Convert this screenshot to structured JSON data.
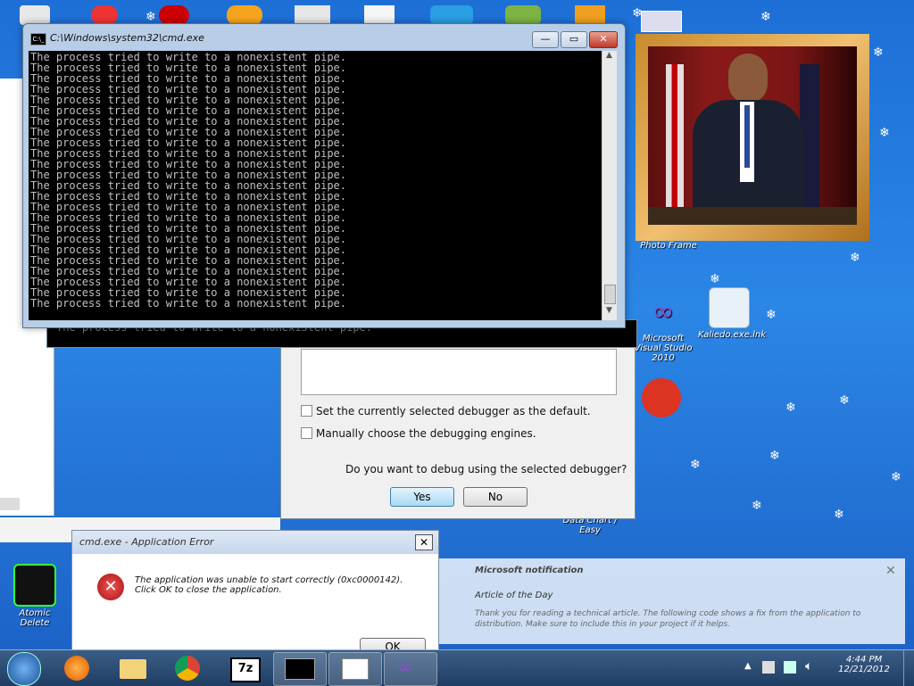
{
  "cmd_window": {
    "title": "C:\\Windows\\system32\\cmd.exe",
    "lines": [
      "The process tried to write to a nonexistent pipe.",
      "The process tried to write to a nonexistent pipe.",
      "The process tried to write to a nonexistent pipe.",
      "The process tried to write to a nonexistent pipe.",
      "The process tried to write to a nonexistent pipe.",
      "The process tried to write to a nonexistent pipe.",
      "The process tried to write to a nonexistent pipe.",
      "The process tried to write to a nonexistent pipe.",
      "The process tried to write to a nonexistent pipe.",
      "The process tried to write to a nonexistent pipe.",
      "The process tried to write to a nonexistent pipe.",
      "The process tried to write to a nonexistent pipe.",
      "The process tried to write to a nonexistent pipe.",
      "The process tried to write to a nonexistent pipe.",
      "The process tried to write to a nonexistent pipe.",
      "The process tried to write to a nonexistent pipe.",
      "The process tried to write to a nonexistent pipe.",
      "The process tried to write to a nonexistent pipe.",
      "The process tried to write to a nonexistent pipe.",
      "The process tried to write to a nonexistent pipe.",
      "The process tried to write to a nonexistent pipe.",
      "The process tried to write to a nonexistent pipe.",
      "The process tried to write to a nonexistent pipe.",
      "The process tried to write to a nonexistent pipe."
    ],
    "minimize": "—",
    "maximize": "▭",
    "close": "✕",
    "console_icon": "C:\\_"
  },
  "behind_console_line": "The process tried to write to a nonexistent pipe.",
  "debug_dialog": {
    "checkbox_default": "Set the currently selected debugger as the default.",
    "checkbox_manual": "Manually choose the debugging engines.",
    "question": "Do you want to debug using the selected debugger?",
    "yes": "Yes",
    "no": "No"
  },
  "error_dialog": {
    "title": "cmd.exe - Application Error",
    "message": "The application was unable to start correctly (0xc0000142). Click OK to close the application.",
    "ok": "OK",
    "close": "✕"
  },
  "desktop_icons": [
    {
      "label": "Photo Frame"
    },
    {
      "label": "Microsoft Visual Studio 2010"
    },
    {
      "label": "Kaliedo.exe.lnk"
    },
    {
      "label": "Data Chart / Easy"
    },
    {
      "label": "Atomic Delete"
    }
  ],
  "photo_caption": "Photo Frame",
  "notification": {
    "title": "Microsoft notification",
    "subtitle": "Article of the Day",
    "body": "Thank you for reading a technical article. The following code shows a fix from the application to distribution. Make sure to include this in your project if it helps."
  },
  "taskbar": {
    "items": [
      "start",
      "firefox",
      "explorer",
      "chrome",
      "7zip",
      "cmd",
      "wordpad",
      "visualstudio"
    ],
    "clock_time": "4:44 PM",
    "clock_date": "12/21/2012",
    "sevenzip": "7z"
  },
  "colors": {
    "desktop": "#2b86e6",
    "taskbar": "#1f3d63",
    "error_red": "#c0392b"
  }
}
